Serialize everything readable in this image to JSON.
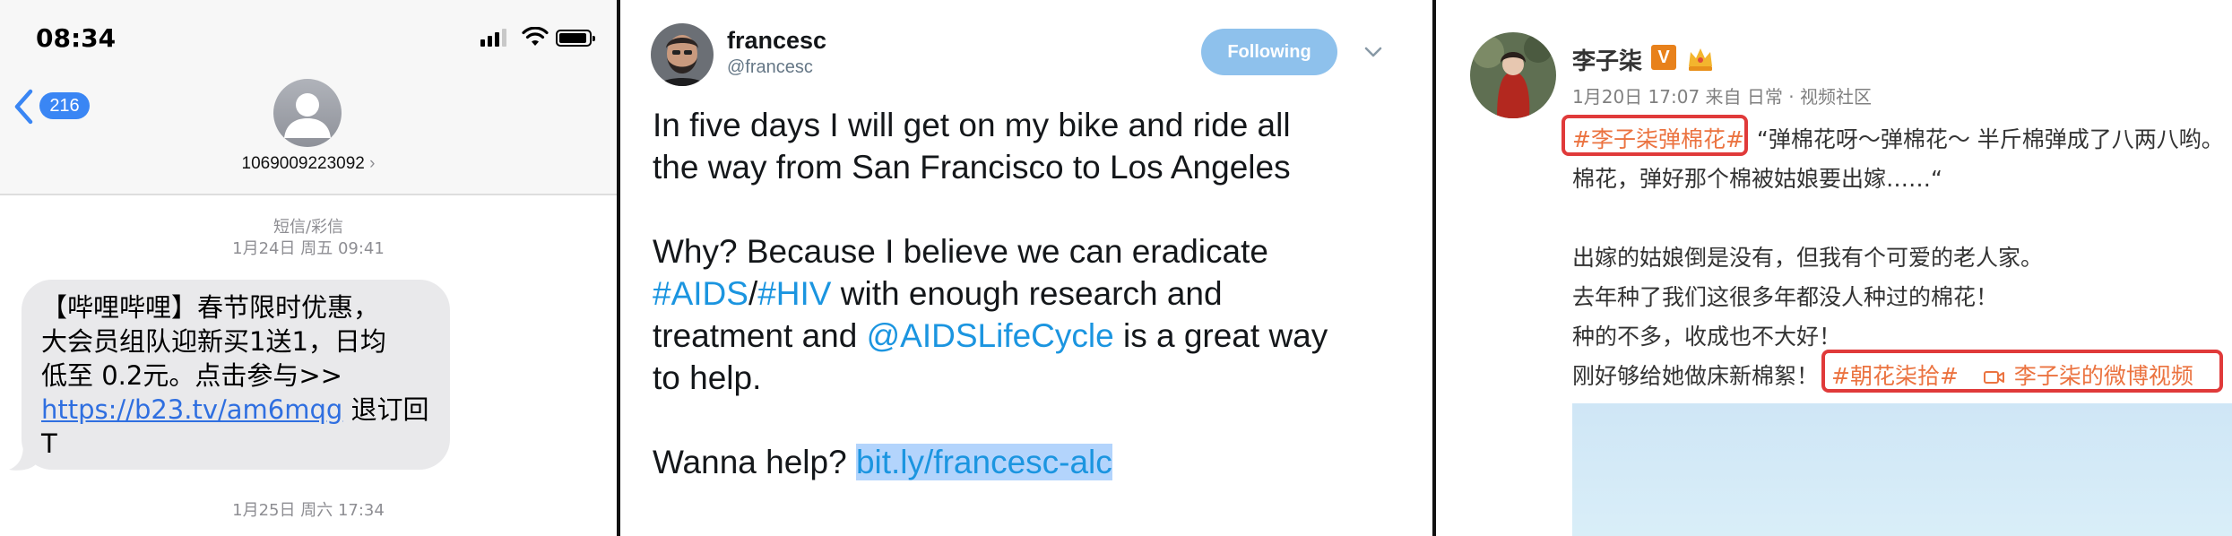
{
  "sms": {
    "status_time": "08:34",
    "back_count": "216",
    "contact_number": "1069009223092",
    "contact_chevron": "›",
    "meta1_type": "短信/彩信",
    "meta1_date": "1月24日 周五 09:41",
    "message": {
      "line1": "【哔哩哔哩】春节限时优惠，",
      "line2": "大会员组队迎新买1送1，日均",
      "line3": "低至 0.2元。点击参与>>",
      "link": "https://b23.tv/am6mqg",
      "after_link": " 退订回",
      "line5": "T"
    },
    "meta2_date": "1月25日 周六 17:34",
    "icons": {
      "back": "chevron-left-icon",
      "signal": "cellular-signal-icon",
      "wifi": "wifi-icon",
      "battery": "battery-icon",
      "avatar": "person-icon"
    },
    "colors": {
      "accent": "#3a86f4",
      "bubble": "#e9e9eb",
      "link": "#2f6fe0"
    }
  },
  "tweet": {
    "name": "francesc",
    "handle": "@francesc",
    "follow_label": "Following",
    "line1": "In five days I will get on my bike and ride all",
    "line2": "the way from San Francisco to Los Angeles",
    "line3": "Why? Because I believe we can eradicate",
    "hashtag_aids": "#AIDS",
    "slash": "/",
    "hashtag_hiv": "#HIV",
    "line4_rest": " with enough research and",
    "line5_a": "treatment and ",
    "mention": "@AIDSLifeCycle",
    "line5_b": " is a great way",
    "line6": "to help.",
    "line7_a": "Wanna help? ",
    "link": "bit.ly/francesc-alc",
    "icons": {
      "menu": "chevron-down-icon"
    },
    "colors": {
      "link": "#1b95e0",
      "follow_button": "#8ec1ec",
      "selection": "#b3d4fc"
    }
  },
  "weibo": {
    "name": "李子柒",
    "v_badge": "V",
    "meta": "1月20日 17:07 来自 日常 · 视频社区",
    "tag1": "#李子柒弹棉花#",
    "quote1": "“弹棉花呀～弹棉花～ 半斤棉弹成了八两八哟。",
    "quote2": "棉花，弹好那个棉被姑娘要出嫁……“",
    "para1": "出嫁的姑娘倒是没有，但我有个可爱的老人家。",
    "para2": "去年种了我们这很多年都没人种过的棉花！",
    "para3": "种的不多，收成也不大好！",
    "para4": "刚好够给她做床新棉絮！",
    "tag2": "#朝花柒拾#",
    "video_label": "李子柒的微博视频",
    "icons": {
      "crown": "crown-icon",
      "video": "video-camera-icon"
    },
    "colors": {
      "tag": "#eb7340",
      "highlight": "#e03a3a",
      "vip": "#e8811b"
    }
  }
}
